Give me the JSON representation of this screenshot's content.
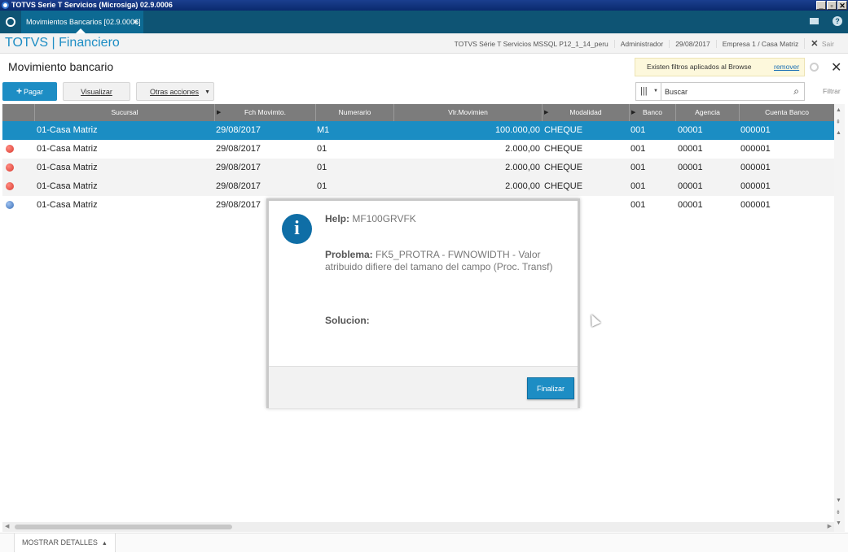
{
  "window": {
    "title": "TOTVS Serie T Servicios (Microsiga) 02.9.0006"
  },
  "tabbar": {
    "active_tab": "Movimientos Bancarios [02.9.0006]",
    "close": "✕"
  },
  "module": {
    "brand": "TOTVS | Financiero",
    "environment": "TOTVS Série T Servicios MSSQL P12_1_14_peru",
    "user": "Administrador",
    "date": "29/08/2017",
    "company": "Empresa 1 / Casa Matriz",
    "exit_label": "Sair"
  },
  "page": {
    "title": "Movimiento bancario",
    "filters_notice": "Existen filtros aplicados al Browse",
    "remove_label": "remover"
  },
  "toolbar": {
    "pay_label": "Pagar",
    "view_label": "Visualizar",
    "other_actions_label": "Otras acciones"
  },
  "search": {
    "placeholder": "Buscar",
    "filter_label": "Filtrar"
  },
  "grid": {
    "columns": [
      "Sucursal",
      "Fch Movimto.",
      "Numerario",
      "Vlr.Movimien",
      "Modalidad",
      "Banco",
      "Agencia",
      "Cuenta Banco"
    ],
    "rows": [
      {
        "status": "selected",
        "status_color": "#1b8dc3",
        "sucursal": "01-Casa Matriz",
        "fecha": "29/08/2017",
        "numerario": "M1",
        "valor": "100.000,00",
        "modalidad": "CHEQUE",
        "banco": "001",
        "agencia": "00001",
        "cuenta": "000001"
      },
      {
        "status": "red",
        "status_color": "#d93a2f",
        "sucursal": "01-Casa Matriz",
        "fecha": "29/08/2017",
        "numerario": "01",
        "valor": "2.000,00",
        "modalidad": "CHEQUE",
        "banco": "001",
        "agencia": "00001",
        "cuenta": "000001"
      },
      {
        "status": "red",
        "status_color": "#d93a2f",
        "sucursal": "01-Casa Matriz",
        "fecha": "29/08/2017",
        "numerario": "01",
        "valor": "2.000,00",
        "modalidad": "CHEQUE",
        "banco": "001",
        "agencia": "00001",
        "cuenta": "000001"
      },
      {
        "status": "red",
        "status_color": "#d93a2f",
        "sucursal": "01-Casa Matriz",
        "fecha": "29/08/2017",
        "numerario": "01",
        "valor": "2.000,00",
        "modalidad": "CHEQUE",
        "banco": "001",
        "agencia": "00001",
        "cuenta": "000001"
      },
      {
        "status": "blue",
        "status_color": "#3a6fb8",
        "sucursal": "01-Casa Matriz",
        "fecha": "29/08/2017",
        "numerario": "",
        "valor": "",
        "modalidad": "",
        "banco": "001",
        "agencia": "00001",
        "cuenta": "000001"
      }
    ]
  },
  "footer": {
    "details_label": "MOSTRAR DETALLES"
  },
  "dialog": {
    "help_label": "Help:",
    "help_value": "MF100GRVFK",
    "problem_label": "Problema:",
    "problem_text": "FK5_PROTRA - FWNOWIDTH - Valor atribuido difiere del tamano del campo (Proc. Transf)",
    "solution_label": "Solucion:",
    "solution_text": "",
    "finish_label": "Finalizar"
  },
  "colors": {
    "accent": "#1d8dc4",
    "header_bar": "#0e5474",
    "grid_header": "#7c7c7c",
    "selected_row": "#1b8dc3"
  }
}
